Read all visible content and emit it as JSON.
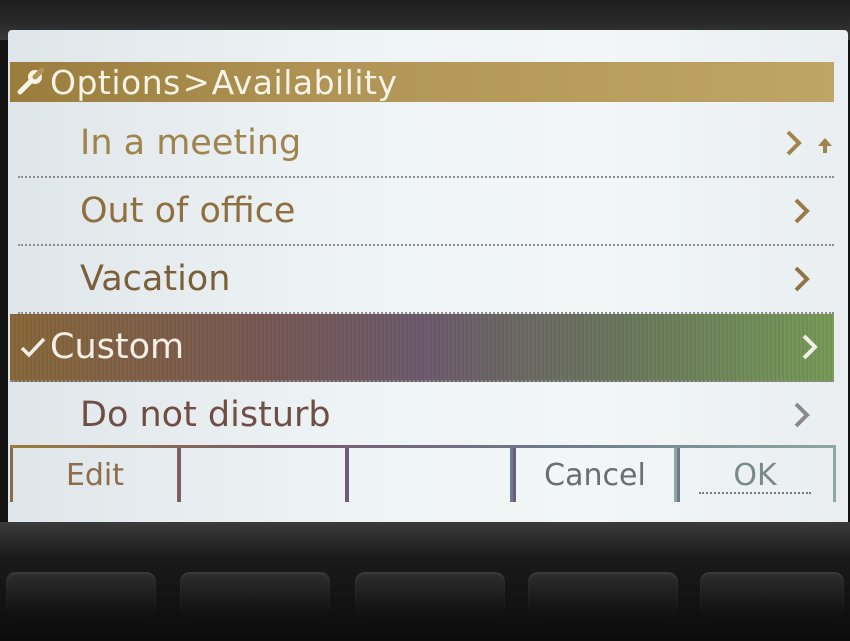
{
  "title_bar": {
    "icon": "wrench-icon",
    "crumb_parent": "Options",
    "separator": ">",
    "crumb_current": "Availability"
  },
  "menu": {
    "items": [
      {
        "label": "In a meeting",
        "selected": false,
        "scroll_up_indicator": true
      },
      {
        "label": "Out of office",
        "selected": false
      },
      {
        "label": "Vacation",
        "selected": false
      },
      {
        "label": "Custom",
        "selected": true,
        "checked": true
      },
      {
        "label": "Do not disturb",
        "selected": false
      }
    ]
  },
  "softkeys": {
    "edit": "Edit",
    "blank_1": "",
    "blank_2": "",
    "cancel": "Cancel",
    "ok": "OK"
  },
  "colors": {
    "title_bar": "#b09557",
    "selected_row_start": "#8a6a3c",
    "selected_row_end": "#789c58",
    "item_text": "#8a6a3c"
  }
}
